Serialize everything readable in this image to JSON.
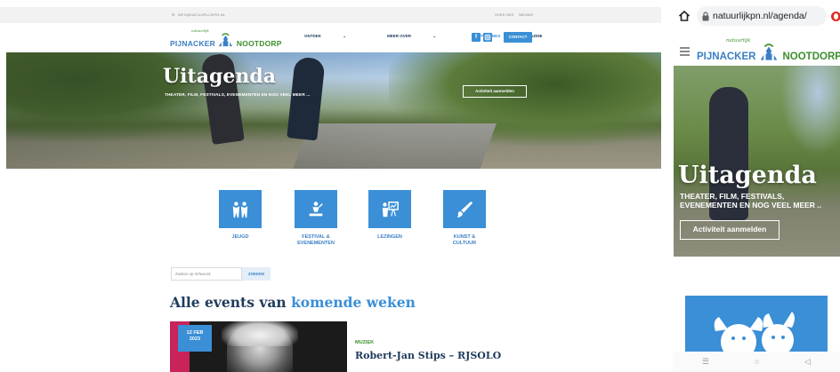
{
  "desktop": {
    "topbar": {
      "email": "INFO@NATUURLIJKPN.NL",
      "links": [
        "OVER ONS",
        "NIEUWS"
      ]
    },
    "logo": {
      "tagline": "natuurlijk",
      "left": "PIJNACKER",
      "right": "NOOTDORP"
    },
    "menu": [
      {
        "label": "ONTDEK",
        "dropdown": true,
        "active": false
      },
      {
        "label": "MEER OVER",
        "dropdown": true,
        "active": false
      },
      {
        "label": "UITAGENDA",
        "dropdown": false,
        "active": true
      },
      {
        "label": "MAGAZINE",
        "dropdown": false,
        "active": false
      }
    ],
    "social": [
      "facebook-icon",
      "instagram-icon"
    ],
    "contact_label": "CONTACT",
    "hero": {
      "title": "Uitagenda",
      "subtitle": "THEATER, FILM, FESTIVALS, EVENEMENTEN EN NOG VEEL MEER ...",
      "button": "Activiteit aanmelden"
    },
    "categories": [
      {
        "label": "JEUGD",
        "icon": "children-icon"
      },
      {
        "label": "FESTIVAL &\nEVENEMENTEN",
        "icon": "performer-icon"
      },
      {
        "label": "LEZINGEN",
        "icon": "lecture-icon"
      },
      {
        "label": "KUNST &\nCULTUUR",
        "icon": "paintbrush-icon"
      }
    ],
    "search": {
      "placeholder": "Zoeken op trefwoord",
      "button": "ZOEKEN"
    },
    "events_heading": {
      "prefix": "Alle events van ",
      "highlight": "komende weken"
    },
    "event": {
      "day": "12 FEB",
      "year": "2023",
      "category": "MUZIEK",
      "title": "Robert-Jan Stips – RJSOLO"
    }
  },
  "mobile": {
    "url": "natuurlijkpn.nl/agenda/",
    "logo": {
      "tagline": "natuurlijk",
      "left": "PIJNACKER",
      "right": "NOOTDORP"
    },
    "hero": {
      "title": "Uitagenda",
      "subtitle": "THEATER, FILM, FESTIVALS, EVENEMENTEN EN NOG VEEL MEER ..",
      "button": "Activiteit aanmelden"
    },
    "nav_icons": [
      "recent-apps-icon",
      "home-circle-icon",
      "back-icon"
    ]
  },
  "colors": {
    "accent": "#3a8fd6",
    "navy": "#1f3b5c",
    "green": "#3d8f2c",
    "pink": "#c8245a"
  }
}
